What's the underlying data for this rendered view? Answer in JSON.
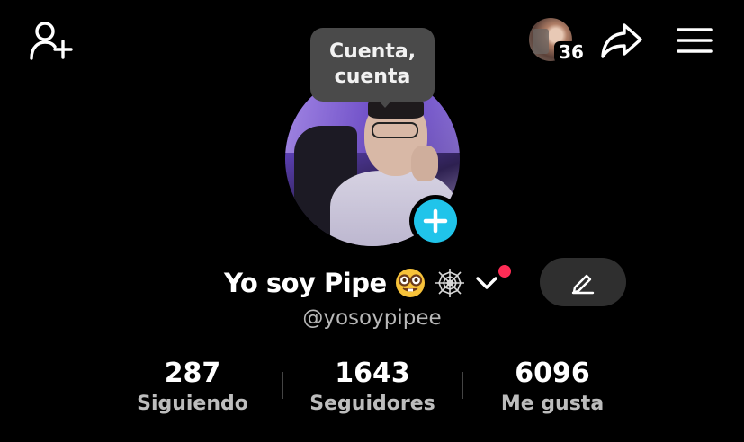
{
  "header": {
    "add_user_icon": "add-user-icon",
    "profile_visitors_count": "36",
    "share_icon": "share-arrow-icon",
    "menu_icon": "hamburger-menu-icon"
  },
  "tooltip": {
    "text": "Cuenta,\ncuenta"
  },
  "profile": {
    "display_name": "Yo soy Pipe",
    "emojis": [
      "nerd-face-emoji",
      "spider-web-emoji"
    ],
    "username": "@yosoypipee",
    "notification_dot_color": "#fe2c55",
    "add_story_color": "#20c4ea"
  },
  "stats": [
    {
      "value": "287",
      "label": "Siguiendo"
    },
    {
      "value": "1643",
      "label": "Seguidores"
    },
    {
      "value": "6096",
      "label": "Me gusta"
    }
  ],
  "edit_icon": "pencil-icon"
}
